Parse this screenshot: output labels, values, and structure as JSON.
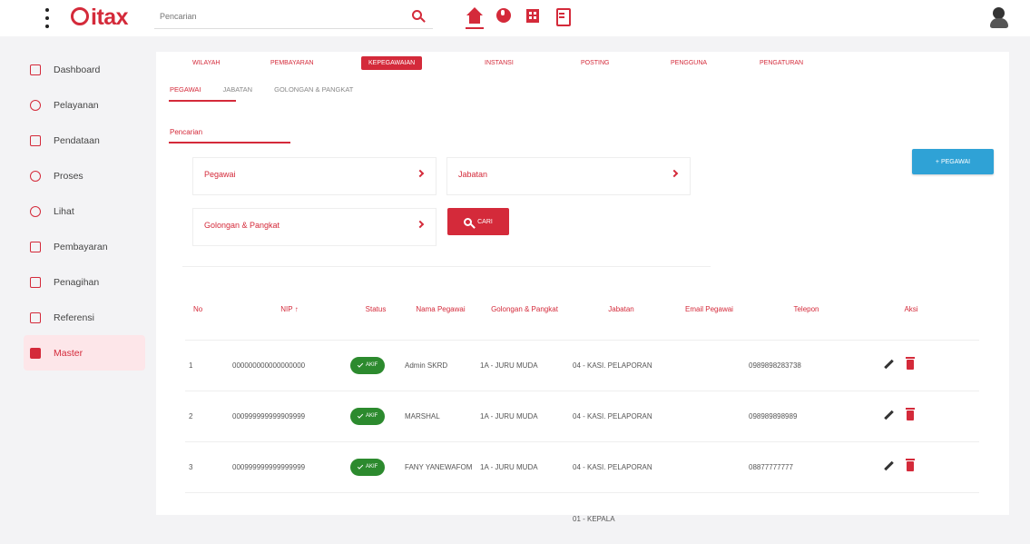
{
  "app": {
    "logo_text": "itax"
  },
  "search": {
    "placeholder": "Pencarian"
  },
  "sidebar": {
    "items": [
      {
        "label": "Dashboard",
        "icon": "home-icon"
      },
      {
        "label": "Pelayanan",
        "icon": "people-icon"
      },
      {
        "label": "Pendataan",
        "icon": "plus-box-icon"
      },
      {
        "label": "Proses",
        "icon": "circle-icon"
      },
      {
        "label": "Lihat",
        "icon": "eye-icon"
      },
      {
        "label": "Pembayaran",
        "icon": "money-icon"
      },
      {
        "label": "Penagihan",
        "icon": "building-icon"
      },
      {
        "label": "Referensi",
        "icon": "book-icon"
      },
      {
        "label": "Master",
        "icon": "file-icon"
      }
    ],
    "active": "Master"
  },
  "topnav": {
    "items": [
      "WILAYAH",
      "PEMBAYARAN",
      "KEPEGAWAIAN",
      "INSTANSI",
      "POSTING",
      "PENGGUNA",
      "PENGATURAN"
    ],
    "active": "KEPEGAWAIAN"
  },
  "subtabs": {
    "items": [
      "PEGAWAI",
      "JABATAN",
      "GOLONGAN & PANGKAT"
    ],
    "active": "PEGAWAI"
  },
  "filter": {
    "section_label": "Pencarian",
    "pegawai": "Pegawai",
    "jabatan": "Jabatan",
    "golongan": "Golongan & Pangkat",
    "cari_label": "CARI"
  },
  "add_button": {
    "label": "+ PEGAWAI"
  },
  "table": {
    "headers": {
      "no": "No",
      "nip": "NIP ↑",
      "status": "Status",
      "nama": "Nama Pegawai",
      "golongan": "Golongan & Pangkat",
      "jabatan": "Jabatan",
      "email": "Email Pegawai",
      "telepon": "Telepon",
      "aksi": "Aksi"
    },
    "rows": [
      {
        "no": "1",
        "nip": "000000000000000000",
        "status": "AKIF",
        "nama": "Admin SKRD",
        "golongan": "1A - JURU MUDA",
        "jabatan": "04 - KASI. PELAPORAN",
        "email": "",
        "telepon": "0989898283738"
      },
      {
        "no": "2",
        "nip": "000999999999909999",
        "status": "AKIF",
        "nama": "MARSHAL",
        "golongan": "1A - JURU MUDA",
        "jabatan": "04 - KASI. PELAPORAN",
        "email": "",
        "telepon": "098989898989"
      },
      {
        "no": "3",
        "nip": "000999999999999999",
        "status": "AKIF",
        "nama": "FANY YANEWAFOM",
        "golongan": "1A - JURU MUDA",
        "jabatan": "04 - KASI. PELAPORAN",
        "email": "",
        "telepon": "08877777777"
      },
      {
        "no": "",
        "nip": "",
        "status": "",
        "nama": "",
        "golongan": "",
        "jabatan": "01 - KEPALA",
        "email": "",
        "telepon": ""
      }
    ]
  },
  "colors": {
    "primary": "#d42a3a",
    "success": "#2c8a2e",
    "info": "#2fa2d6",
    "active_bg": "#fde6e9"
  }
}
